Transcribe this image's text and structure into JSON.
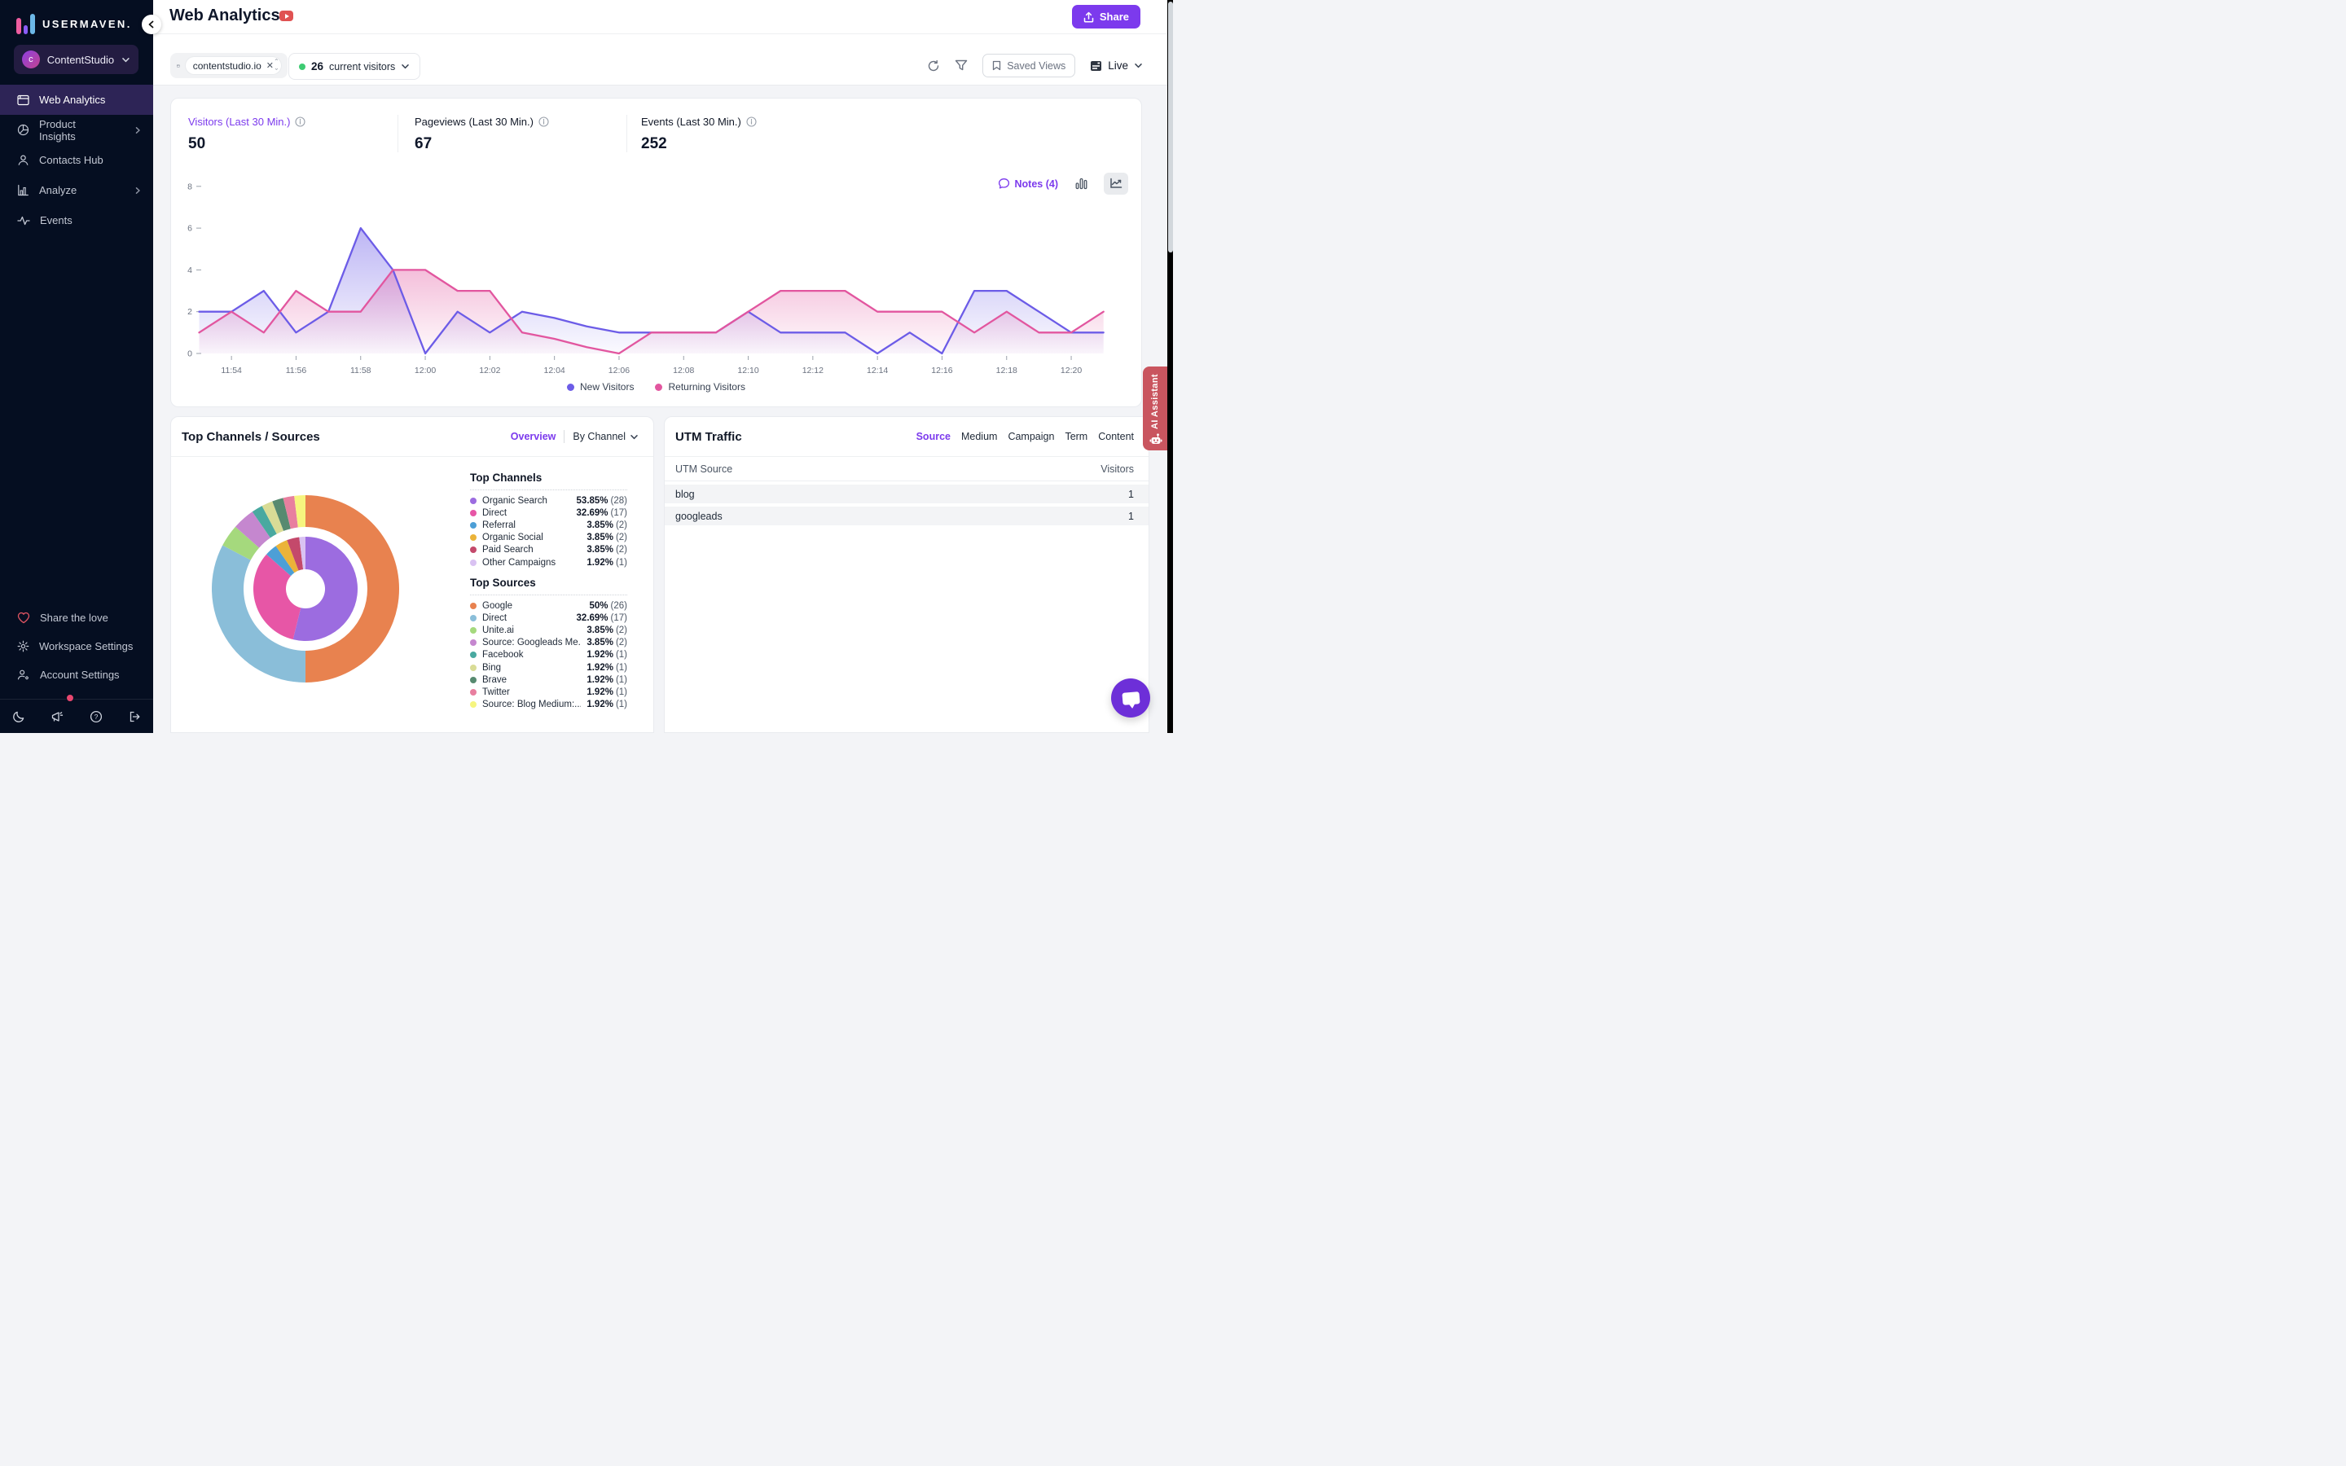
{
  "app": {
    "logo_text": "USERMAVEN.",
    "workspace": {
      "initial": "c",
      "name": "ContentStudio"
    }
  },
  "sidebar": {
    "items": [
      {
        "label": "Web Analytics",
        "icon": "browser-icon",
        "active": true,
        "chevron": false
      },
      {
        "label": "Product Insights",
        "icon": "pie-icon",
        "active": false,
        "chevron": true
      },
      {
        "label": "Contacts Hub",
        "icon": "user-icon",
        "active": false,
        "chevron": false
      },
      {
        "label": "Analyze",
        "icon": "bar-chart-icon",
        "active": false,
        "chevron": true
      },
      {
        "label": "Events",
        "icon": "pulse-icon",
        "active": false,
        "chevron": false
      }
    ],
    "footer_items": [
      {
        "label": "Share the love",
        "icon": "heart-icon"
      },
      {
        "label": "Workspace Settings",
        "icon": "gear-icon"
      },
      {
        "label": "Account Settings",
        "icon": "user-gear-icon"
      }
    ]
  },
  "header": {
    "title": "Web Analytics",
    "share_label": "Share"
  },
  "filters": {
    "domain_chip": "contentstudio.io",
    "current_visitors_count": "26",
    "current_visitors_label": "current visitors",
    "saved_views_label": "Saved Views",
    "live_label": "Live",
    "online_color": "#3ecb72"
  },
  "stats": {
    "items": [
      {
        "label": "Visitors (Last 30 Min.)",
        "value": "50",
        "accent": true
      },
      {
        "label": "Pageviews (Last 30 Min.)",
        "value": "67",
        "accent": false
      },
      {
        "label": "Events (Last 30 Min.)",
        "value": "252",
        "accent": false
      }
    ]
  },
  "chart": {
    "notes_label": "Notes (4)"
  },
  "chart_data": [
    {
      "type": "area",
      "title": "Visitors timeline (per minute)",
      "x": [
        "11:53",
        "11:54",
        "11:55",
        "11:56",
        "11:57",
        "11:58",
        "11:59",
        "12:00",
        "12:01",
        "12:02",
        "12:03",
        "12:04",
        "12:05",
        "12:06",
        "12:07",
        "12:08",
        "12:09",
        "12:10",
        "12:11",
        "12:12",
        "12:13",
        "12:14",
        "12:15",
        "12:16",
        "12:17",
        "12:18",
        "12:19",
        "12:20",
        "12:21"
      ],
      "xticks": [
        "11:54",
        "11:56",
        "11:58",
        "12:00",
        "12:02",
        "12:04",
        "12:06",
        "12:08",
        "12:10",
        "12:12",
        "12:14",
        "12:16",
        "12:18",
        "12:20"
      ],
      "ylim": [
        0,
        8
      ],
      "yticks": [
        0,
        2,
        4,
        6,
        8
      ],
      "grid": false,
      "legend_position": "bottom",
      "series": [
        {
          "name": "New Visitors",
          "color": "#6c5ce7",
          "values": [
            2,
            2,
            3,
            1,
            2,
            6,
            4,
            0,
            2,
            1,
            2,
            1.7,
            1.3,
            1,
            1,
            1,
            1,
            2,
            1,
            1,
            1,
            0,
            1,
            0,
            3,
            3,
            2,
            1,
            1
          ]
        },
        {
          "name": "Returning Visitors",
          "color": "#e2569f",
          "values": [
            1,
            2,
            1,
            3,
            2,
            2,
            4,
            4,
            3,
            3,
            1,
            0.7,
            0.3,
            0,
            1,
            1,
            1,
            2,
            3,
            3,
            3,
            2,
            2,
            2,
            1,
            2,
            1,
            1,
            2
          ]
        }
      ]
    },
    {
      "type": "donut",
      "title": "Top Channels / Sources",
      "rings": [
        {
          "name": "Top Sources",
          "position": "outer",
          "labels": [
            "Google",
            "Direct",
            "Unite.ai",
            "Source: Googleads Me...",
            "Facebook",
            "Bing",
            "Brave",
            "Twitter",
            "Source: Blog Medium:..."
          ],
          "values": [
            50,
            32.69,
            3.85,
            3.85,
            1.92,
            1.92,
            1.92,
            1.92,
            1.92
          ],
          "colors": [
            "#e8824f",
            "#8abed9",
            "#a5d97d",
            "#c587cf",
            "#49a9a0",
            "#d9dc96",
            "#578a70",
            "#e87f9f",
            "#f6f57f"
          ]
        },
        {
          "name": "Top Channels",
          "position": "inner",
          "labels": [
            "Organic Search",
            "Direct",
            "Referral",
            "Organic Social",
            "Paid Search",
            "Other Campaigns"
          ],
          "values": [
            53.85,
            32.69,
            3.85,
            3.85,
            3.85,
            1.92
          ],
          "colors": [
            "#9c6ce0",
            "#e756a6",
            "#4d9fd6",
            "#ebb339",
            "#c4496b",
            "#d9c2f2"
          ]
        }
      ]
    }
  ],
  "channels_panel": {
    "title": "Top Channels / Sources",
    "overview_label": "Overview",
    "by_channel_label": "By Channel",
    "channels": {
      "title": "Top Channels",
      "rows": [
        {
          "label": "Organic Search",
          "pct": "53.85%",
          "count": "(28)",
          "color": "#9c6ce0"
        },
        {
          "label": "Direct",
          "pct": "32.69%",
          "count": "(17)",
          "color": "#e756a6"
        },
        {
          "label": "Referral",
          "pct": "3.85%",
          "count": "(2)",
          "color": "#4d9fd6"
        },
        {
          "label": "Organic Social",
          "pct": "3.85%",
          "count": "(2)",
          "color": "#ebb339"
        },
        {
          "label": "Paid Search",
          "pct": "3.85%",
          "count": "(2)",
          "color": "#c4496b"
        },
        {
          "label": "Other Campaigns",
          "pct": "1.92%",
          "count": "(1)",
          "color": "#d9c2f2"
        }
      ]
    },
    "sources": {
      "title": "Top Sources",
      "rows": [
        {
          "label": "Google",
          "pct": "50%",
          "count": "(26)",
          "color": "#e8824f"
        },
        {
          "label": "Direct",
          "pct": "32.69%",
          "count": "(17)",
          "color": "#8abed9"
        },
        {
          "label": "Unite.ai",
          "pct": "3.85%",
          "count": "(2)",
          "color": "#a5d97d"
        },
        {
          "label": "Source: Googleads Me...",
          "pct": "3.85%",
          "count": "(2)",
          "color": "#c587cf"
        },
        {
          "label": "Facebook",
          "pct": "1.92%",
          "count": "(1)",
          "color": "#49a9a0"
        },
        {
          "label": "Bing",
          "pct": "1.92%",
          "count": "(1)",
          "color": "#d9dc96"
        },
        {
          "label": "Brave",
          "pct": "1.92%",
          "count": "(1)",
          "color": "#578a70"
        },
        {
          "label": "Twitter",
          "pct": "1.92%",
          "count": "(1)",
          "color": "#e87f9f"
        },
        {
          "label": "Source: Blog Medium:...",
          "pct": "1.92%",
          "count": "(1)",
          "color": "#f6f57f"
        }
      ]
    }
  },
  "utm_panel": {
    "title": "UTM Traffic",
    "tabs": [
      "Source",
      "Medium",
      "Campaign",
      "Term",
      "Content"
    ],
    "active_tab": "Source",
    "columns": [
      "UTM Source",
      "Visitors"
    ],
    "rows": [
      {
        "source": "blog",
        "visitors": "1"
      },
      {
        "source": "googleads",
        "visitors": "1"
      }
    ]
  },
  "misc": {
    "ai_assistant_label": "AI Assistant",
    "accent_color": "#7c3aed",
    "ai_tab_color": "#c9555f"
  }
}
